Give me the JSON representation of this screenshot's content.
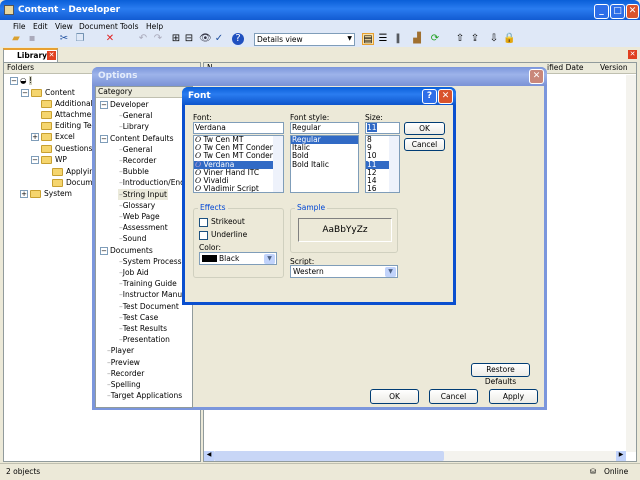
{
  "window": {
    "title": "Content - Developer"
  },
  "menu": [
    "File",
    "Edit",
    "View",
    "Document",
    "Tools",
    "Help"
  ],
  "toolbar": {
    "view_select": "Details view"
  },
  "tab": {
    "label": "Library"
  },
  "folders": {
    "header": "Folders",
    "root": "!",
    "items": [
      "Content",
      "Additional Top",
      "Attachments",
      "Editing Techni",
      "Excel",
      "Questions and",
      "WP",
      "Applying F",
      "Document",
      "System"
    ]
  },
  "columns": {
    "name": "N",
    "modified": "ified Date",
    "version": "Version"
  },
  "status": {
    "count": "2 objects",
    "online": "Online"
  },
  "options": {
    "title": "Options",
    "category_header": "Category",
    "tree": [
      {
        "label": "Developer",
        "level": 0
      },
      {
        "label": "General",
        "level": 1
      },
      {
        "label": "Library",
        "level": 1
      },
      {
        "label": "Content Defaults",
        "level": 0
      },
      {
        "label": "General",
        "level": 1
      },
      {
        "label": "Recorder",
        "level": 1
      },
      {
        "label": "Bubble",
        "level": 1
      },
      {
        "label": "Introduction/End Fra",
        "level": 1
      },
      {
        "label": "String Input",
        "level": 1
      },
      {
        "label": "Glossary",
        "level": 1
      },
      {
        "label": "Web Page",
        "level": 1
      },
      {
        "label": "Assessment",
        "level": 1
      },
      {
        "label": "Sound",
        "level": 1
      },
      {
        "label": "Documents",
        "level": 0
      },
      {
        "label": "System Process",
        "level": 1
      },
      {
        "label": "Job Aid",
        "level": 1
      },
      {
        "label": "Training Guide",
        "level": 1
      },
      {
        "label": "Instructor Manual",
        "level": 1
      },
      {
        "label": "Test Document",
        "level": 1
      },
      {
        "label": "Test Case",
        "level": 1
      },
      {
        "label": "Test Results",
        "level": 1
      },
      {
        "label": "Presentation",
        "level": 1
      },
      {
        "label": "Player",
        "level": 0
      },
      {
        "label": "Preview",
        "level": 0
      },
      {
        "label": "Recorder",
        "level": 0
      },
      {
        "label": "Spelling",
        "level": 0
      },
      {
        "label": "Target Applications",
        "level": 0
      }
    ],
    "restore": "Restore Defaults",
    "ok": "OK",
    "cancel": "Cancel",
    "apply": "Apply"
  },
  "font": {
    "title": "Font",
    "help": "?",
    "font_label": "Font:",
    "font_value": "Verdana",
    "fonts": [
      "Tw Cen MT",
      "Tw Cen MT Condense",
      "Tw Cen MT Condense",
      "Verdana",
      "Viner Hand ITC",
      "Vivaldi",
      "Vladimir Script"
    ],
    "style_label": "Font style:",
    "style_value": "Regular",
    "styles": [
      "Regular",
      "Italic",
      "Bold",
      "Bold Italic"
    ],
    "size_label": "Size:",
    "size_value": "11",
    "sizes": [
      "8",
      "9",
      "10",
      "11",
      "12",
      "14",
      "16"
    ],
    "ok": "OK",
    "cancel": "Cancel",
    "effects_label": "Effects",
    "strikeout": "Strikeout",
    "underline": "Underline",
    "color_label": "Color:",
    "color_value": "Black",
    "sample_label": "Sample",
    "sample_text": "AaBbYyZz",
    "script_label": "Script:",
    "script_value": "Western"
  }
}
